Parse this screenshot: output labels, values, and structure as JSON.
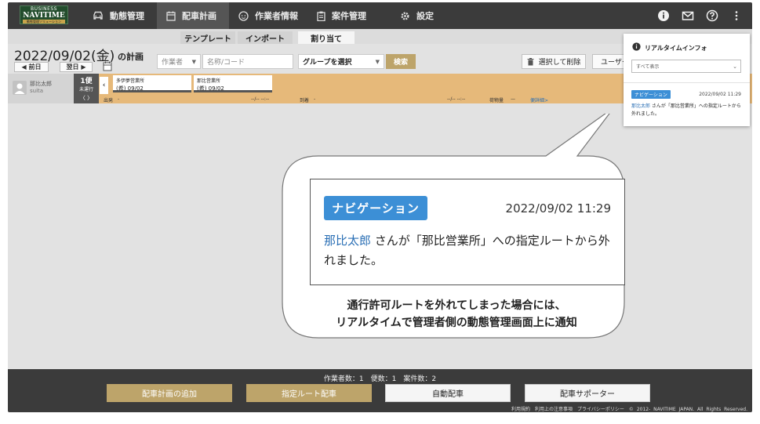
{
  "app": {
    "logo_line1": "BUSINESS",
    "logo_line2": "NAVITIME",
    "logo_line3": "動態管理ソリューション"
  },
  "nav": {
    "items": [
      {
        "label": "動態管理",
        "icon": "car-icon"
      },
      {
        "label": "配車計画",
        "icon": "calendar-icon",
        "active": true
      },
      {
        "label": "作業者情報",
        "icon": "face-icon"
      },
      {
        "label": "案件管理",
        "icon": "clipboard-icon"
      },
      {
        "label": "設定",
        "icon": "gear-icon"
      }
    ],
    "right_icons": [
      "info-icon",
      "mail-icon",
      "help-icon",
      "more-vertical-icon"
    ]
  },
  "subtabs": [
    {
      "label": "テンプレート"
    },
    {
      "label": "インポート"
    },
    {
      "label": "割り当て",
      "active": true
    }
  ],
  "header": {
    "date": "2022/09/02(金)",
    "suffix": "の計画",
    "prev_label": "◀ 前日",
    "next_label": "翌日 ▶",
    "worker_select": "作業者",
    "name_placeholder": "名称/コード",
    "group_select": "グループを選択",
    "search_label": "検索",
    "delete_label": "選択して削除",
    "user_label": "ユーザー"
  },
  "route": {
    "worker_name": "那比太郎",
    "worker_id": "suita",
    "trip_count": "1便",
    "trip_status": "未運行",
    "trip_arrows": "〈  〉",
    "stops": [
      {
        "name": "多伊夢営業所",
        "date": "(希) 09/02"
      },
      {
        "name": "那比営業所",
        "date": "(希) 09/02"
      }
    ],
    "depart_label": "出発",
    "depart_value": "-",
    "time1": "--/-- --:--",
    "arrive_label": "到着",
    "arrive_value": "-",
    "time2": "--/-- --:--",
    "cargo_label": "荷物量",
    "cargo_value": "—",
    "detail_link": "便詳細>"
  },
  "realtime": {
    "title": "リアルタイムインフォ",
    "filter": "すべて表示",
    "badge": "ナビゲーション",
    "time": "2022/09/02 11:29",
    "user": "那比太郎",
    "message": " さんが「那比営業所」への指定ルートから外れました。"
  },
  "zoom": {
    "badge": "ナビゲーション",
    "time": "2022/09/02 11:29",
    "user": "那比太郎",
    "message": " さんが「那比営業所」への指定ルートから外れました。"
  },
  "caption": {
    "line1": "通行許可ルートを外れてしまった場合には、",
    "line2": "リアルタイムで管理者側の動態管理画面上に通知"
  },
  "footer": {
    "counts": "作業者数：1　便数：1　案件数：2",
    "buttons": [
      {
        "label": "配車計画の追加",
        "style": "gold"
      },
      {
        "label": "指定ルート配車",
        "style": "gold"
      },
      {
        "label": "自動配車",
        "style": "white"
      },
      {
        "label": "配車サポーター",
        "style": "white"
      }
    ],
    "links": "利用規約　利用上の注意事項　プライバシーポリシー　© 2012- NAVITIME JAPAN. All Rights Reserved."
  },
  "colors": {
    "nav_bg": "#3b3b3b",
    "route_row": "#e6b97a",
    "gold_button": "#bda46a",
    "badge_blue": "#3c8fd6",
    "link_blue": "#2a6fb5"
  }
}
